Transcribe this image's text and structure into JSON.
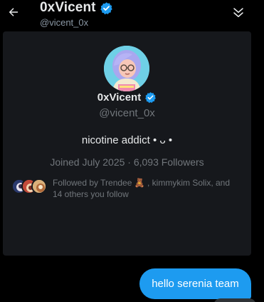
{
  "header": {
    "name": "0xVicent",
    "handle": "@vicent_0x"
  },
  "profile": {
    "name": "0xVicent",
    "handle": "@vicent_0x",
    "bio": "nicotine addict • ᴗ •",
    "meta": "Joined July 2025 · 6,093 Followers",
    "followed_by": "Followed by Trendee 🧸 , kimmykim Solix, and 14 others you follow"
  },
  "message": {
    "text": "hello serenia team"
  },
  "colors": {
    "accent": "#1d9bf0",
    "verified": "#1d9bf0",
    "card_bg": "#16181c"
  },
  "icons": {
    "back": "back-arrow-icon",
    "verified": "verified-badge-icon",
    "collapse": "double-chevron-down-icon"
  }
}
